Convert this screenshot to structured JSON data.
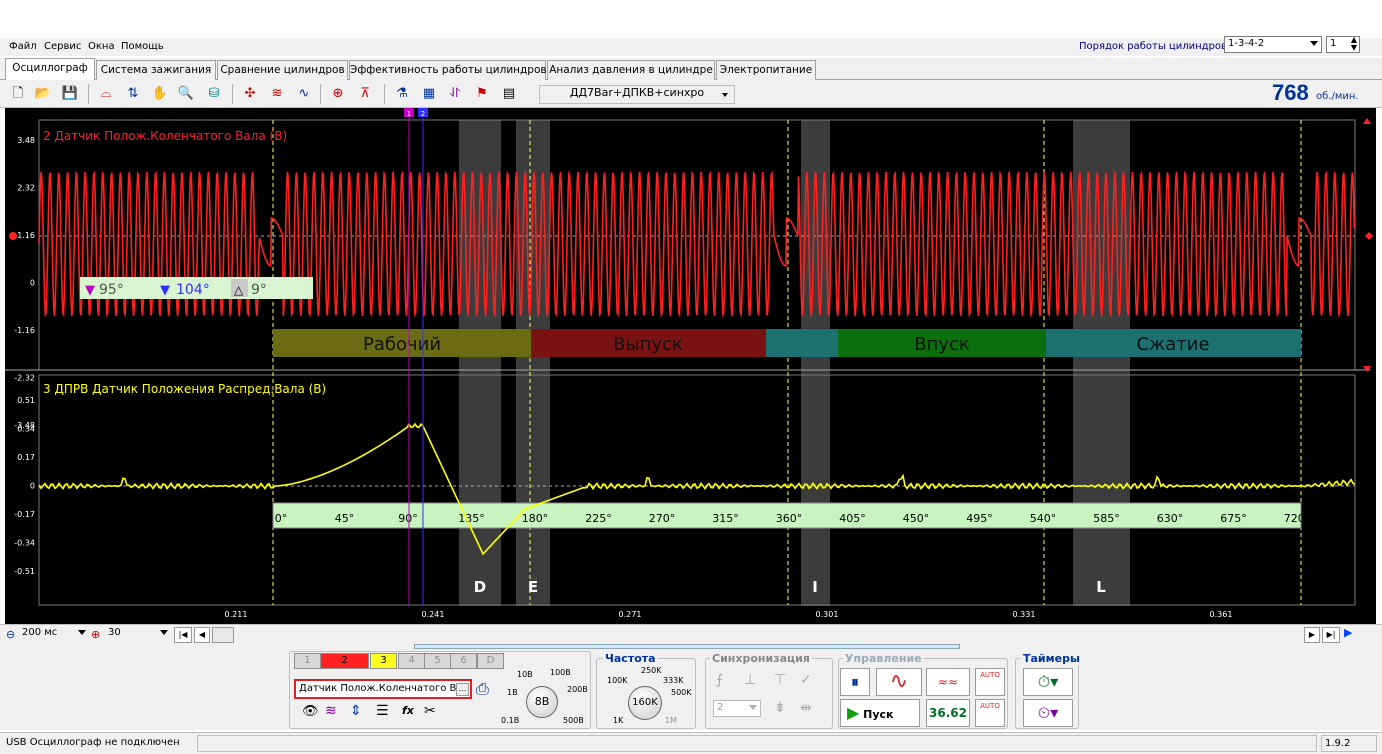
{
  "menu": {
    "items": [
      "Файл",
      "Сервис",
      "Окна",
      "Помощь"
    ]
  },
  "cylinder_order": {
    "label": "Порядок работы цилиндров",
    "value": "1-3-4-2",
    "cylinder": "1"
  },
  "tabs": [
    "Осциллограф",
    "Система зажигания",
    "Сравнение цилиндров",
    "Эффективность работы цилиндров",
    "Анализ давления в цилиндре",
    "Электропитание"
  ],
  "active_tab": 0,
  "toolbar": {
    "preset": "ДД7Bar+ДПКВ+синхро",
    "rpm": "768",
    "rpm_unit": "об./мин."
  },
  "scope": {
    "ch2": {
      "title": "2 Датчик Полож.Коленчатого Вала (В)",
      "color": "#ff2020",
      "yticks": [
        "3.48",
        "2.32",
        "1.16",
        "0",
        "-1.16",
        "-2.32",
        "-3.48"
      ]
    },
    "ch3": {
      "title": "3 ДПРВ Датчик Положения Распред.Вала (В)",
      "color": "#ffff00",
      "yticks": [
        "0.51",
        "0.34",
        "0.17",
        "0",
        "-0.17",
        "-0.34",
        "-0.51"
      ]
    },
    "cursor_readout": {
      "c1": "95°",
      "c2": "104°",
      "delta": "9°"
    },
    "phases": [
      {
        "name": "Рабочий",
        "color": "#6b6b14"
      },
      {
        "name": "Выпуск",
        "color": "#7a1212"
      },
      {
        "name": "Впуск",
        "color": "#0d6e0d"
      },
      {
        "name": "Сжатие",
        "color": "#1d7070"
      }
    ],
    "degree_scale": [
      "0°",
      "45°",
      "90°",
      "135°",
      "180°",
      "225°",
      "270°",
      "315°",
      "360°",
      "405°",
      "450°",
      "495°",
      "540°",
      "585°",
      "630°",
      "675°",
      "720°"
    ],
    "markers": [
      "D",
      "E",
      "I",
      "L"
    ],
    "cursor_labels": [
      "1",
      "2"
    ],
    "time_ticks": [
      "0.211",
      "0.241",
      "0.271",
      "0.301",
      "0.331",
      "0.361"
    ]
  },
  "timebase": {
    "time": "200 мс",
    "count": "30"
  },
  "channels": {
    "buttons": [
      "1",
      "2",
      "3",
      "4",
      "5",
      "6",
      "D"
    ],
    "selected_name": "Датчик Полож.Коленчатого Ва",
    "ellipsis": "..."
  },
  "voltage_knob": {
    "labels": [
      "10В",
      "100В",
      "1В",
      "200В",
      "0.1В",
      "500В"
    ],
    "value": "8В"
  },
  "frequency": {
    "title": "Частота",
    "labels": [
      "100K",
      "250K",
      "333K",
      "500K",
      "1K",
      "1M"
    ],
    "value": "160K"
  },
  "sync": {
    "title": "Синхронизация",
    "channel": "2"
  },
  "control": {
    "title": "Управление",
    "start": "Пуск",
    "value": "36.62",
    "auto": "AUTO"
  },
  "timers": {
    "title": "Таймеры"
  },
  "status": {
    "text": "USB Осциллограф не подключен",
    "version": "1.9.2"
  }
}
